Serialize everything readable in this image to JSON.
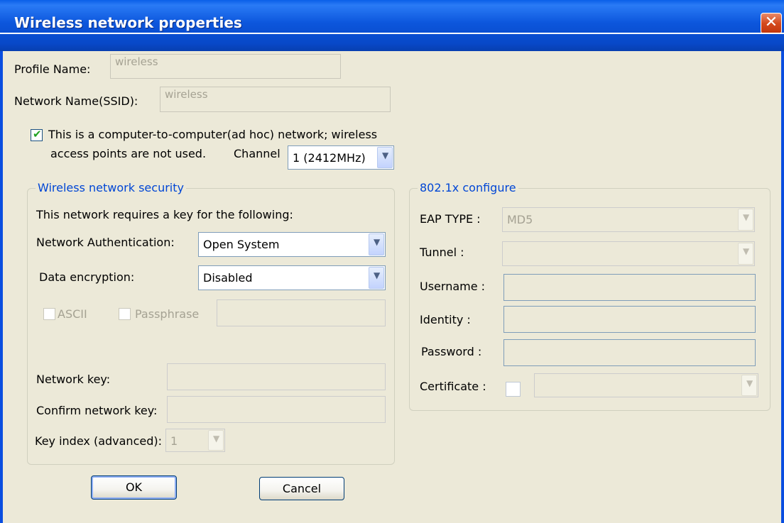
{
  "window": {
    "title": "Wireless network properties",
    "close_glyph": "✕"
  },
  "profile": {
    "label": "Profile Name:",
    "value": "wireless"
  },
  "ssid": {
    "label": "Network Name(SSID):",
    "value": "wireless"
  },
  "adhoc": {
    "checked": true,
    "line1": "This is a computer-to-computer(ad hoc) network; wireless",
    "line2": "access points are not used.",
    "channel_label": "Channel",
    "channel_value": "1  (2412MHz)"
  },
  "security": {
    "group_title": "Wireless network security",
    "intro": "This network requires a key for the following:",
    "auth_label": "Network Authentication:",
    "auth_value": "Open System",
    "encryption_label": "Data encryption:",
    "encryption_value": "Disabled",
    "ascii_label": "ASCII",
    "passphrase_label": "Passphrase",
    "network_key_label": "Network key:",
    "confirm_key_label": "Confirm network key:",
    "key_index_label": "Key index (advanced):",
    "key_index_value": "1"
  },
  "dot1x": {
    "group_title": "802.1x configure",
    "eap_label": "EAP TYPE :",
    "eap_value": "MD5",
    "tunnel_label": "Tunnel :",
    "username_label": "Username :",
    "identity_label": "Identity :",
    "password_label": "Password :",
    "certificate_label": "Certificate :"
  },
  "buttons": {
    "ok": "OK",
    "cancel": "Cancel"
  },
  "colors": {
    "titlebar": "#0a5fe8",
    "dialog_bg": "#ece9d8",
    "group_title": "#0046d5",
    "close_button": "#d44a1e"
  }
}
